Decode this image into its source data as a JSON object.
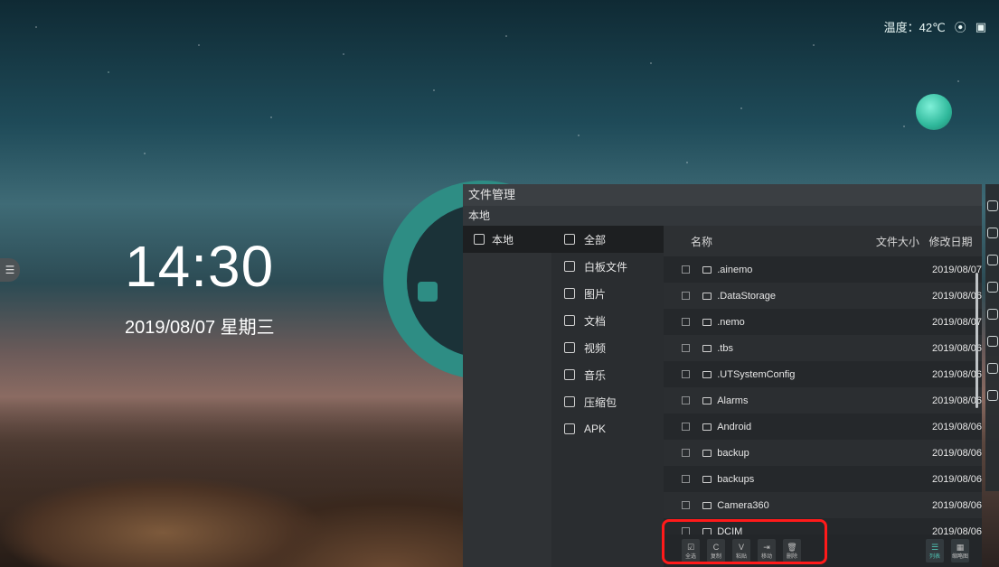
{
  "topbar": {
    "temp_label": "温度：42℃",
    "wifi_icon": "wifi-hotspot-icon",
    "screen_icon": "screen-cast-icon"
  },
  "desktop": {
    "time": "14:30",
    "date": "2019/08/07  星期三"
  },
  "file_manager": {
    "title": "文件管理",
    "breadcrumb": "本地",
    "locations": [
      {
        "label": "本地",
        "icon": "computer-icon"
      }
    ],
    "categories": [
      {
        "label": "全部",
        "icon": "all-files-icon"
      },
      {
        "label": "白板文件",
        "icon": "whiteboard-icon"
      },
      {
        "label": "图片",
        "icon": "image-icon"
      },
      {
        "label": "文档",
        "icon": "document-icon"
      },
      {
        "label": "视频",
        "icon": "video-icon"
      },
      {
        "label": "音乐",
        "icon": "music-icon"
      },
      {
        "label": "压缩包",
        "icon": "archive-icon"
      },
      {
        "label": "APK",
        "icon": "apk-icon"
      }
    ],
    "columns": {
      "name": "名称",
      "size": "文件大小",
      "date": "修改日期"
    },
    "files": [
      {
        "name": ".ainemo",
        "size": "",
        "date": "2019/08/07"
      },
      {
        "name": ".DataStorage",
        "size": "",
        "date": "2019/08/06"
      },
      {
        "name": ".nemo",
        "size": "",
        "date": "2019/08/07"
      },
      {
        "name": ".tbs",
        "size": "",
        "date": "2019/08/06"
      },
      {
        "name": ".UTSystemConfig",
        "size": "",
        "date": "2019/08/06"
      },
      {
        "name": "Alarms",
        "size": "",
        "date": "2019/08/06"
      },
      {
        "name": "Android",
        "size": "",
        "date": "2019/08/06"
      },
      {
        "name": "backup",
        "size": "",
        "date": "2019/08/06"
      },
      {
        "name": "backups",
        "size": "",
        "date": "2019/08/06"
      },
      {
        "name": "Camera360",
        "size": "",
        "date": "2019/08/06"
      },
      {
        "name": "DCIM",
        "size": "",
        "date": "2019/08/06"
      }
    ],
    "toolbar": {
      "select_all": "全选",
      "copy": "复制",
      "paste": "粘贴",
      "move": "移动",
      "delete": "删除",
      "list_view": "列表",
      "thumb_view": "缩略图"
    }
  },
  "colors": {
    "accent": "#2e8d84",
    "highlight": "#ff1a1a",
    "list_active": "#4fc3b3"
  }
}
